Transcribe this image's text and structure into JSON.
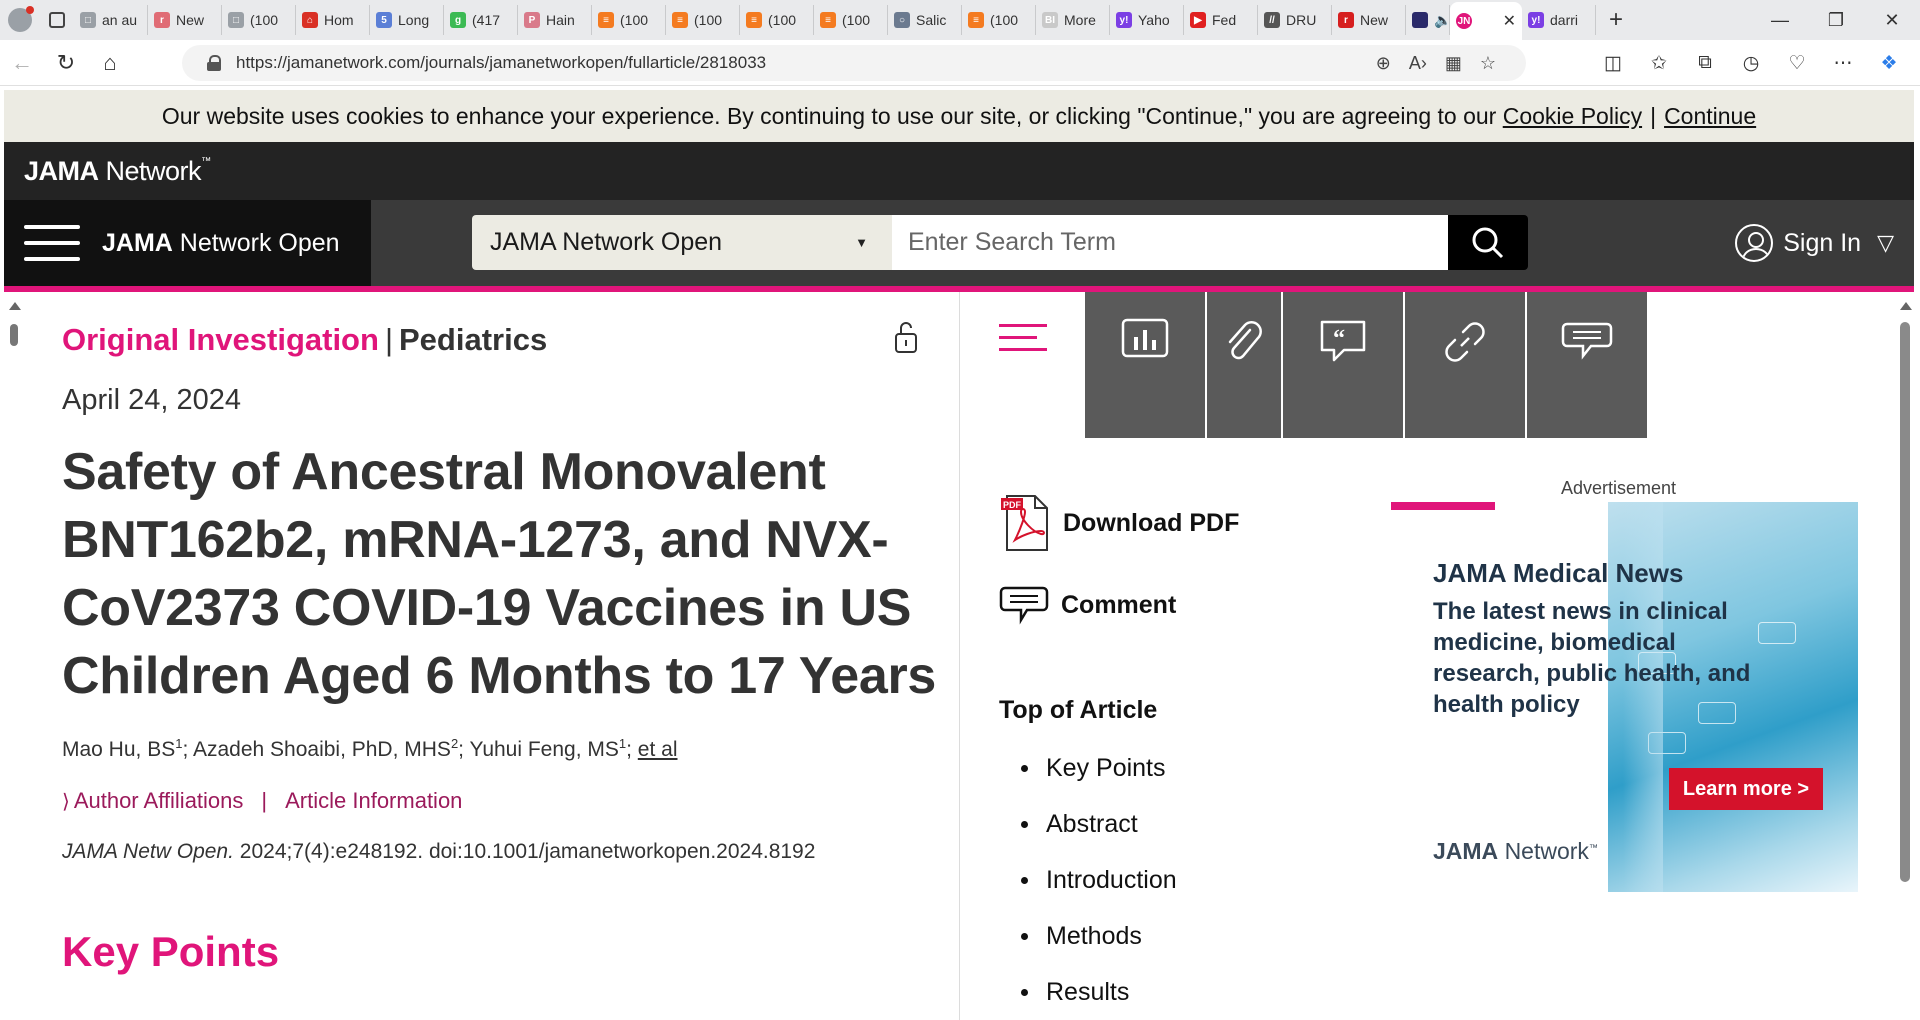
{
  "browser": {
    "tabs": [
      {
        "title": "an au",
        "fav_color": "#9aa0a6",
        "icon": "document-icon"
      },
      {
        "title": "New",
        "fav_color": "#e06c75",
        "icon": "r-icon"
      },
      {
        "title": "(100",
        "fav_color": "#9aa0a6",
        "icon": "document-icon"
      },
      {
        "title": "Hom",
        "fav_color": "#d93025",
        "icon": "home-icon"
      },
      {
        "title": "Long",
        "fav_color": "#5b7fd6",
        "icon": "five-icon"
      },
      {
        "title": "(417",
        "fav_color": "#3cba54",
        "icon": "g-icon"
      },
      {
        "title": "Hain",
        "fav_color": "#d97a8a",
        "icon": "p-icon"
      },
      {
        "title": "(100",
        "fav_color": "#f47b20",
        "icon": "substack-icon"
      },
      {
        "title": "(100",
        "fav_color": "#f47b20",
        "icon": "substack-icon"
      },
      {
        "title": "(100",
        "fav_color": "#f47b20",
        "icon": "substack-icon"
      },
      {
        "title": "(100",
        "fav_color": "#f47b20",
        "icon": "substack-icon"
      },
      {
        "title": "Salic",
        "fav_color": "#6b7a8f",
        "icon": "circle-icon"
      },
      {
        "title": "(100",
        "fav_color": "#f47b20",
        "icon": "substack-icon"
      },
      {
        "title": "More",
        "fav_color": "#c9c9c9",
        "icon": "bi-icon"
      },
      {
        "title": "Yaho",
        "fav_color": "#7b3fe4",
        "icon": "yahoo-icon"
      },
      {
        "title": "Fed",
        "fav_color": "#e02020",
        "icon": "youtube-icon"
      },
      {
        "title": "DRU",
        "fav_color": "#555555",
        "icon": "slash-icon"
      },
      {
        "title": "New",
        "fav_color": "#d61f1f",
        "icon": "r-icon"
      }
    ],
    "audio_tab_icon": "speaker-icon",
    "active_tab": {
      "title": "JN",
      "fav_color": "#e0157a"
    },
    "last_tab": {
      "title": "darri",
      "fav_color": "#7b3fe4"
    },
    "url": "https://jamanetwork.com/journals/jamanetworkopen/fullarticle/2818033"
  },
  "cookie_banner": {
    "text": "Our website uses cookies to enhance your experience. By continuing to use our site, or clicking \"Continue,\" you are agreeing to our",
    "policy_link": "Cookie Policy",
    "separator": "|",
    "continue_link": "Continue"
  },
  "header": {
    "brand_bold": "JAMA",
    "brand_rest": "Network",
    "site_bold": "JAMA",
    "site_rest": "Network Open",
    "search_scope": "JAMA Network Open",
    "search_placeholder": "Enter Search Term",
    "signin_label": "Sign In"
  },
  "article": {
    "type": "Original Investigation",
    "separator": "|",
    "section": "Pediatrics",
    "date": "April 24, 2024",
    "title": "Safety of Ancestral Monovalent BNT162b2, mRNA-1273, and NVX-CoV2373 COVID-19 Vaccines in US Children Aged 6 Months to 17 Years",
    "authors": [
      {
        "name": "Mao Hu, BS",
        "sup": "1"
      },
      {
        "name": "Azadeh Shoaibi, PhD, MHS",
        "sup": "2"
      },
      {
        "name": "Yuhui Feng, MS",
        "sup": "1"
      }
    ],
    "et_al": "et al",
    "links": {
      "affiliations": "Author Affiliations",
      "bar": "|",
      "info": "Article Information"
    },
    "citation_journal": "JAMA Netw Open.",
    "citation_rest": "2024;7(4):e248192. doi:10.1001/jamanetworkopen.2024.8192",
    "first_heading": "Key Points"
  },
  "sidebar": {
    "download_pdf": "Download PDF",
    "comment": "Comment",
    "toc_heading": "Top of Article",
    "toc": [
      "Key Points",
      "Abstract",
      "Introduction",
      "Methods",
      "Results"
    ]
  },
  "ad": {
    "label": "Advertisement",
    "heading": "JAMA Medical News",
    "body": "The latest news in clinical medicine, biomedical research, public health, and health policy",
    "button": "Learn more >",
    "logo_bold": "JAMA",
    "logo_rest": "Network"
  },
  "colors": {
    "accent": "#e0157a",
    "link": "#9b1a5b",
    "dark": "#232323",
    "ad_button": "#d4122b"
  }
}
